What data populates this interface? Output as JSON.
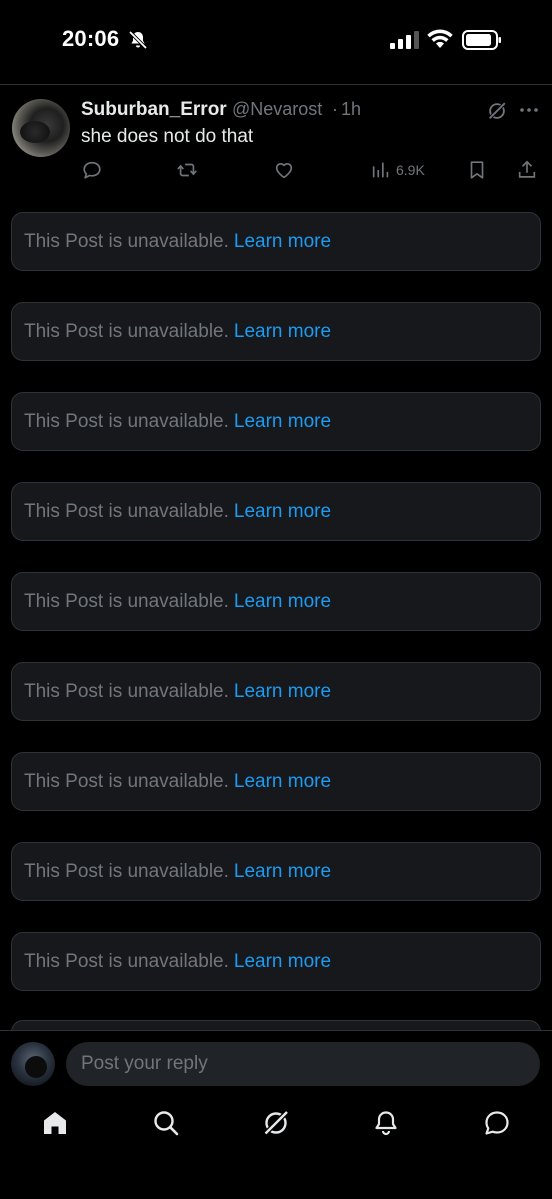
{
  "status_bar": {
    "time": "20:06",
    "icons": [
      "bell-off-icon",
      "signal-icon",
      "wifi-icon",
      "battery-icon"
    ]
  },
  "post": {
    "display_name": "Suburban_Error",
    "handle": "@Nevarost",
    "separator": "·",
    "time": "1h",
    "text": "she does not do that",
    "views": "6.9K",
    "icons": [
      "grok-icon",
      "more-icon",
      "reply-icon",
      "retweet-icon",
      "like-icon",
      "views-icon",
      "bookmark-icon",
      "share-icon"
    ]
  },
  "unavailable_cards": [
    {
      "message": "This Post is unavailable.",
      "link": "Learn more"
    },
    {
      "message": "This Post is unavailable.",
      "link": "Learn more"
    },
    {
      "message": "This Post is unavailable.",
      "link": "Learn more"
    },
    {
      "message": "This Post is unavailable.",
      "link": "Learn more"
    },
    {
      "message": "This Post is unavailable.",
      "link": "Learn more"
    },
    {
      "message": "This Post is unavailable.",
      "link": "Learn more"
    },
    {
      "message": "This Post is unavailable.",
      "link": "Learn more"
    },
    {
      "message": "This Post is unavailable.",
      "link": "Learn more"
    },
    {
      "message": "This Post is unavailable.",
      "link": "Learn more"
    }
  ],
  "reply": {
    "placeholder": "Post your reply"
  },
  "tab_bar": {
    "tabs": [
      "home-icon",
      "search-icon",
      "grok-icon",
      "notifications-icon",
      "messages-icon"
    ]
  },
  "colors": {
    "background": "#000000",
    "text": "#e7e9ea",
    "muted": "#71767b",
    "accent": "#1d9bf0",
    "card": "#16181c",
    "border": "#2f3336"
  }
}
